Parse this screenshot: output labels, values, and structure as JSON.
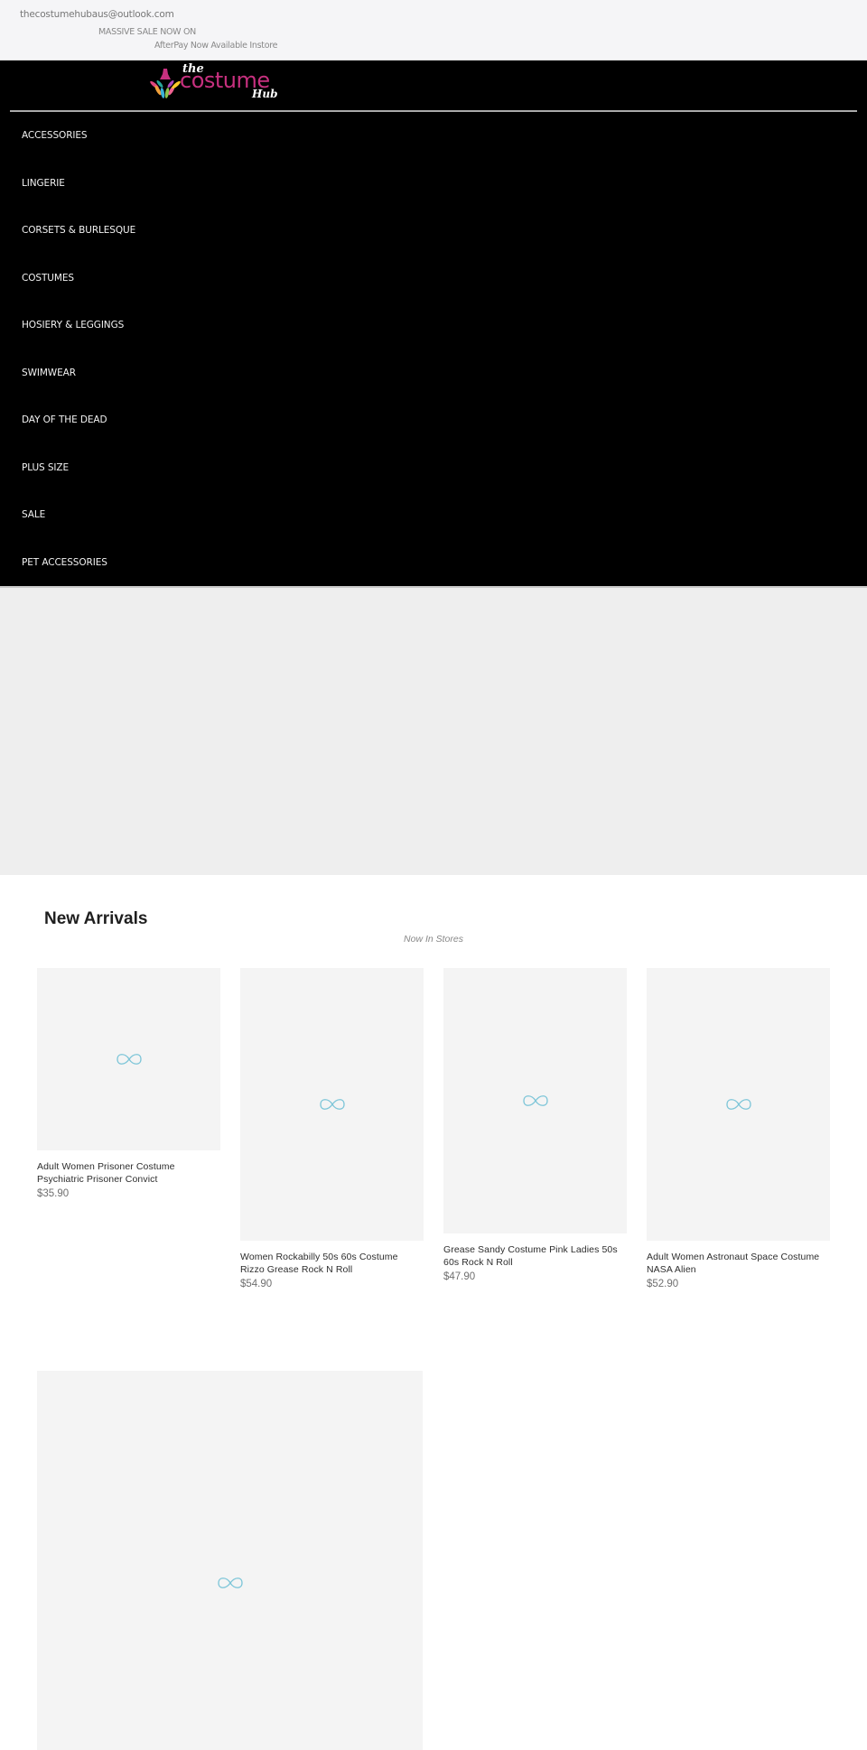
{
  "topbar": {
    "email": "thecostumehubaus@outlook.com",
    "sale_text": "MASSIVE SALE NOW ON",
    "afterpay_text": "AfterPay Now Available Instore"
  },
  "header": {
    "logo": {
      "the": "the",
      "costume": "costume",
      "hub": "Hub",
      "brand_color": "#c7307f",
      "icon": "dress-logo-icon"
    },
    "nav": [
      {
        "label": "ACCESSORIES"
      },
      {
        "label": "LINGERIE"
      },
      {
        "label": "CORSETS & BURLESQUE"
      },
      {
        "label": "COSTUMES"
      },
      {
        "label": "HOSIERY & LEGGINGS"
      },
      {
        "label": "SWIMWEAR"
      },
      {
        "label": "DAY OF THE DEAD"
      },
      {
        "label": "PLUS SIZE"
      },
      {
        "label": "SALE"
      },
      {
        "label": "PET ACCESSORIES"
      }
    ]
  },
  "new_arrivals": {
    "title": "New Arrivals",
    "subtitle": "Now In Stores",
    "loading_icon": "infinity-loader-icon",
    "loading_color": "#7cc5d8",
    "products": [
      {
        "title": "Adult Women Prisoner Costume Psychiatric Prisoner Convict",
        "price": "$35.90"
      },
      {
        "title": "Women Rockabilly 50s 60s Costume Rizzo Grease Rock N Roll",
        "price": "$54.90"
      },
      {
        "title": "Grease Sandy Costume Pink Ladies 50s 60s Rock N Roll",
        "price": "$47.90"
      },
      {
        "title": "Adult Women Astronaut Space Costume NASA Alien",
        "price": "$52.90"
      }
    ]
  }
}
